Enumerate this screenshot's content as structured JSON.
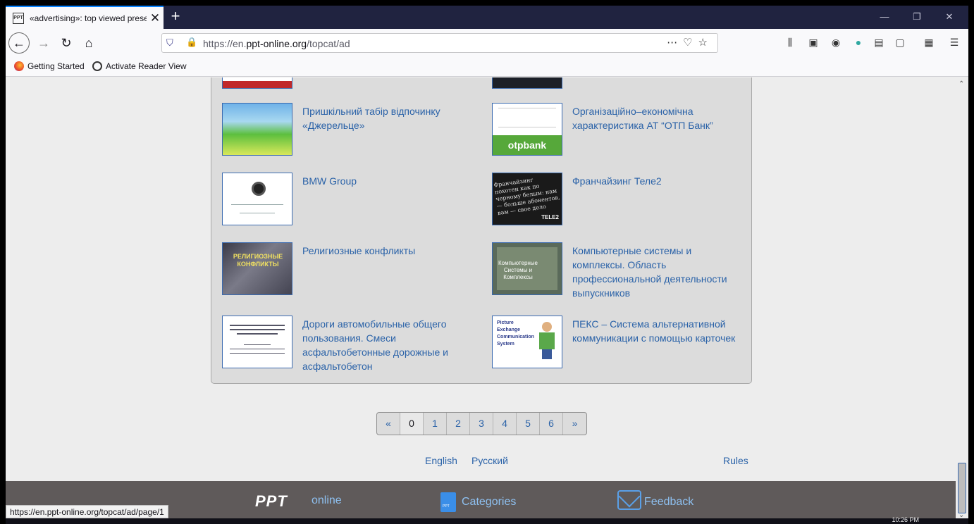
{
  "browser": {
    "tab_title": "«advertising»: top viewed prese",
    "tab_favicon": "PPT",
    "new_tab": "+",
    "url_scheme": "https://en.",
    "url_domain": "ppt-online.org",
    "url_path": "/topcat/ad",
    "bookmarks": [
      {
        "label": "Getting Started",
        "icon": "firefox-icon"
      },
      {
        "label": "Activate Reader View",
        "icon": "globe-icon"
      }
    ]
  },
  "items": [
    {
      "title": "Пришкільний табір відпочинку «Джерельце»",
      "thumb": "camp"
    },
    {
      "title": "Організаційно–економічна характеристика АТ “ОТП Банк”",
      "thumb": "otp",
      "thumb_text": "otpbank"
    },
    {
      "title": "BMW Group",
      "thumb": "bmw"
    },
    {
      "title": "Франчайзинг Теле2",
      "thumb": "tele2",
      "thumb_text": "Франчайзинг похотен как по черному белым: нам — больше абонентов, вам — свое дело",
      "thumb_tag": "TELE2"
    },
    {
      "title": "Религиозные конфликты",
      "thumb": "rel",
      "thumb_text": "РЕЛИГИОЗНЫЕ КОНФЛИКТЫ"
    },
    {
      "title": "Компьютерные системы и комплексы. Область профессиональной деятельности выпускников",
      "thumb": "comp",
      "thumb_text": "Компьютерные Системы и Комплексы"
    },
    {
      "title": "Дороги автомобильные общего пользования. Смеси асфальтобетонные дорожные и асфальтобетон",
      "thumb": "road"
    },
    {
      "title": "ПЕКС – Система альтернативной коммуникации с помощью карточек",
      "thumb": "pecs",
      "thumb_letters": [
        "Picture",
        "Exchange",
        "Communication",
        "System"
      ]
    }
  ],
  "pager": [
    "«",
    "0",
    "1",
    "2",
    "3",
    "4",
    "5",
    "6",
    "»"
  ],
  "pager_active": "0",
  "footer_links": {
    "english": "English",
    "russian": "Русский",
    "rules": "Rules"
  },
  "footer": {
    "logo": "PPT",
    "online": "online",
    "categories": "Categories",
    "categories_icon_text": "PPT",
    "feedback": "Feedback"
  },
  "status_url": "https://en.ppt-online.org/topcat/ad/page/1",
  "clock": "10:26 PM"
}
